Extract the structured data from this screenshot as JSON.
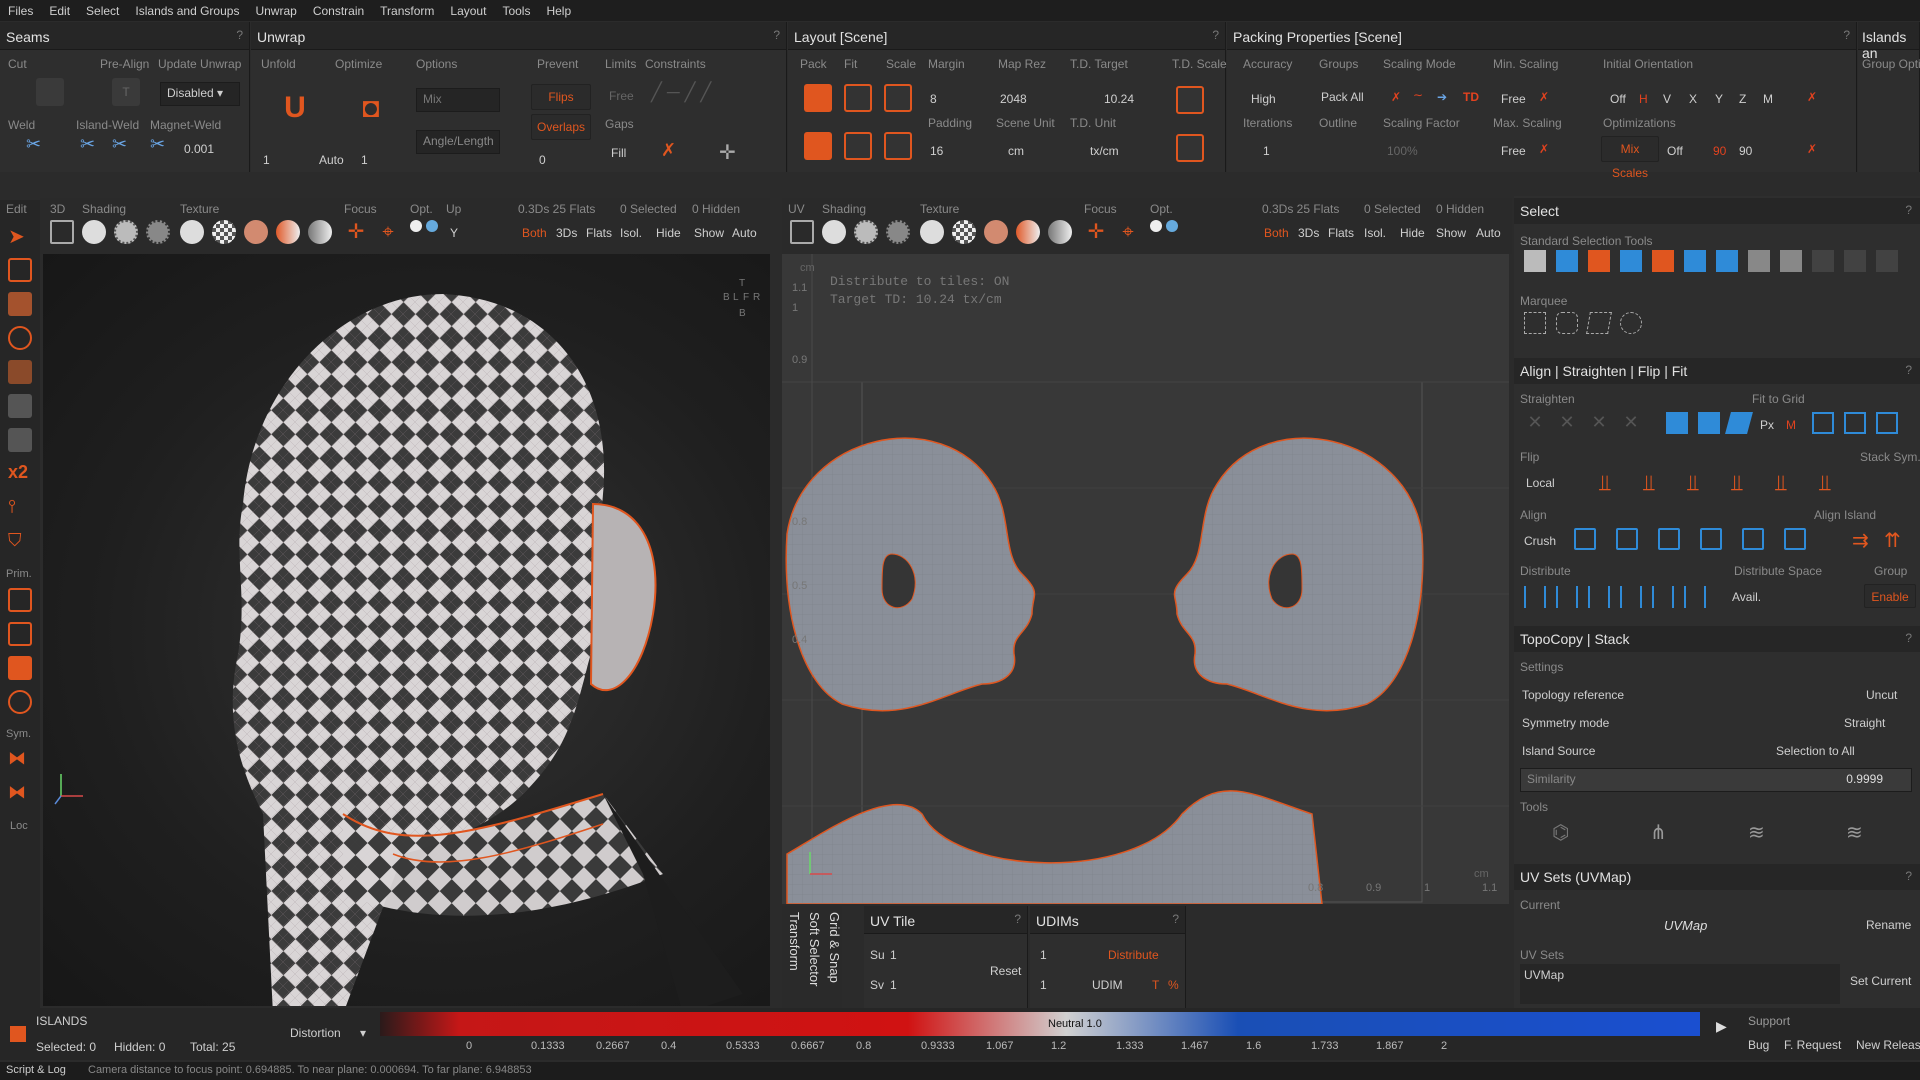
{
  "menu": [
    "Files",
    "Edit",
    "Select",
    "Islands and Groups",
    "Unwrap",
    "Constrain",
    "Transform",
    "Layout",
    "Tools",
    "Help"
  ],
  "seams": {
    "title": "Seams",
    "cut": "Cut",
    "pre_align": "Pre-Align",
    "update_unwrap": "Update Unwrap",
    "disabled": "Disabled",
    "weld": "Weld",
    "island_weld": "Island-Weld",
    "magnet_weld": "Magnet-Weld",
    "magnet_val": "0.001"
  },
  "unwrap": {
    "title": "Unwrap",
    "unfold": "Unfold",
    "optimize": "Optimize",
    "options": "Options",
    "prevent": "Prevent",
    "limits": "Limits",
    "constraints": "Constraints",
    "mix": "Mix",
    "flips": "Flips",
    "free": "Free",
    "overlaps": "Overlaps",
    "gaps": "Gaps",
    "fill": "Fill",
    "angle_length": "Angle/Length",
    "iter1": "1",
    "auto": "Auto",
    "iter2": "1",
    "gaps_val": "0"
  },
  "layout": {
    "title": "Layout [Scene]",
    "pack": "Pack",
    "fit": "Fit",
    "scale": "Scale",
    "margin": "Margin",
    "margin_val": "8",
    "map_rez": "Map Rez",
    "map_rez_val": "2048",
    "td_target": "T.D. Target",
    "td_target_val": "10.24",
    "td_scale": "T.D. Scale",
    "padding": "Padding",
    "padding_val": "16",
    "scene_unit": "Scene Unit",
    "scene_unit_val": "cm",
    "td_unit": "T.D. Unit",
    "td_unit_val": "tx/cm"
  },
  "packing": {
    "title": "Packing Properties [Scene]",
    "accuracy": "Accuracy",
    "accuracy_val": "High",
    "groups": "Groups",
    "pack_all": "Pack All",
    "scaling_mode": "Scaling Mode",
    "min_scaling": "Min. Scaling",
    "free": "Free",
    "initial_orientation": "Initial Orientation",
    "off": "Off",
    "h": "H",
    "v": "V",
    "x": "X",
    "y": "Y",
    "z": "Z",
    "m": "M",
    "iterations": "Iterations",
    "iterations_val": "1",
    "outline": "Outline",
    "scaling_factor": "Scaling Factor",
    "scaling_factor_val": "100%",
    "max_scaling": "Max. Scaling",
    "optimizations": "Optimizations",
    "mix_scales": "Mix Scales",
    "off2": "Off",
    "deg1": "90",
    "deg2": "90",
    "td": "TD"
  },
  "islands_panel": {
    "title": "Islands an",
    "group_opt": "Group Opti"
  },
  "view3d": {
    "edit": "Edit",
    "mode": "3D",
    "shading": "Shading",
    "texture": "Texture",
    "focus": "Focus",
    "opt": "Opt.",
    "up": "Up",
    "up_val": "Y",
    "info": "0.3Ds 25 Flats",
    "selected": "0 Selected",
    "hidden": "0 Hidden",
    "both": "Both",
    "3ds": "3Ds",
    "flats": "Flats",
    "isol": "Isol.",
    "hide": "Hide",
    "show": "Show",
    "auto": "Auto",
    "cube_t": "T",
    "cube_b": "B",
    "cube_l": "L",
    "cube_f": "F",
    "cube_r": "R",
    "cube_bk": "B"
  },
  "viewuv": {
    "mode": "UV",
    "shading": "Shading",
    "texture": "Texture",
    "focus": "Focus",
    "opt": "Opt.",
    "info": "0.3Ds 25 Flats",
    "selected": "0 Selected",
    "hidden": "0 Hidden",
    "both": "Both",
    "3ds": "3Ds",
    "flats": "Flats",
    "isol": "Isol.",
    "hide": "Hide",
    "show": "Show",
    "auto": "Auto",
    "unit": "cm",
    "overlay1": "Distribute to tiles: ON",
    "overlay2": "Target TD: 10.24 tx/cm",
    "ticks_y": [
      "1.1",
      "1",
      "0.9",
      "0.8",
      "0.5",
      "0.4"
    ],
    "ticks_x": [
      "0.8",
      "0.9",
      "1",
      "1.1"
    ],
    "cm2": "cm"
  },
  "sidebar_left": {
    "prim": "Prim.",
    "sym": "Sym.",
    "loc": "Loc",
    "x2": "x2"
  },
  "uvtile": {
    "tabs": [
      "Transform",
      "Soft Selector",
      "Grid & Snap"
    ],
    "title": "UV Tile",
    "su": "Su",
    "su_val": "1",
    "sv": "Sv",
    "sv_val": "1",
    "reset": "Reset"
  },
  "udims": {
    "title": "UDIMs",
    "v1": "1",
    "v2": "1",
    "distribute": "Distribute",
    "udim": "UDIM",
    "t": "T",
    "pct": "%"
  },
  "select": {
    "title": "Select",
    "standard": "Standard Selection Tools",
    "marquee": "Marquee"
  },
  "align": {
    "title": "Align | Straighten | Flip | Fit",
    "straighten": "Straighten",
    "fit_to_grid": "Fit to Grid",
    "px": "Px",
    "m": "M",
    "flip": "Flip",
    "local": "Local",
    "stack_sym": "Stack Sym.",
    "align": "Align",
    "align_island": "Align Island",
    "crush": "Crush",
    "distribute": "Distribute",
    "distribute_space": "Distribute Space",
    "group": "Group",
    "avail": "Avail.",
    "enable": "Enable"
  },
  "topocopy": {
    "title": "TopoCopy | Stack",
    "settings": "Settings",
    "topo_ref": "Topology reference",
    "topo_ref_val": "Uncut",
    "sym_mode": "Symmetry mode",
    "sym_mode_val": "Straight",
    "island_source": "Island Source",
    "island_source_val": "Selection to All",
    "similarity": "Similarity",
    "similarity_val": "0.9999",
    "tools": "Tools"
  },
  "uvsets": {
    "title": "UV Sets (UVMap)",
    "current": "Current",
    "current_val": "UVMap",
    "rename": "Rename",
    "uv_sets": "UV Sets",
    "item": "UVMap",
    "set_current": "Set Current"
  },
  "bottom": {
    "islands": "ISLANDS",
    "selected": "Selected: 0",
    "hidden": "Hidden: 0",
    "total": "Total: 25",
    "distortion": "Distortion",
    "neutral": "Neutral 1.0",
    "ticks": [
      "0",
      "0.1333",
      "0.2667",
      "0.4",
      "0.5333",
      "0.6667",
      "0.8",
      "0.9333",
      "1.067",
      "1.2",
      "1.333",
      "1.467",
      "1.6",
      "1.733",
      "1.867",
      "2"
    ],
    "support": "Support",
    "bug": "Bug",
    "f_request": "F. Request",
    "new_release": "New Release"
  },
  "status": {
    "script_log": "Script & Log",
    "message": "Camera distance to focus point: 0.694885. To near plane: 0.000694. To far plane: 6.948853"
  },
  "colors": {
    "accent": "#e0561f",
    "panel": "#2e2e2e",
    "uv_island": "#8a8f99"
  }
}
